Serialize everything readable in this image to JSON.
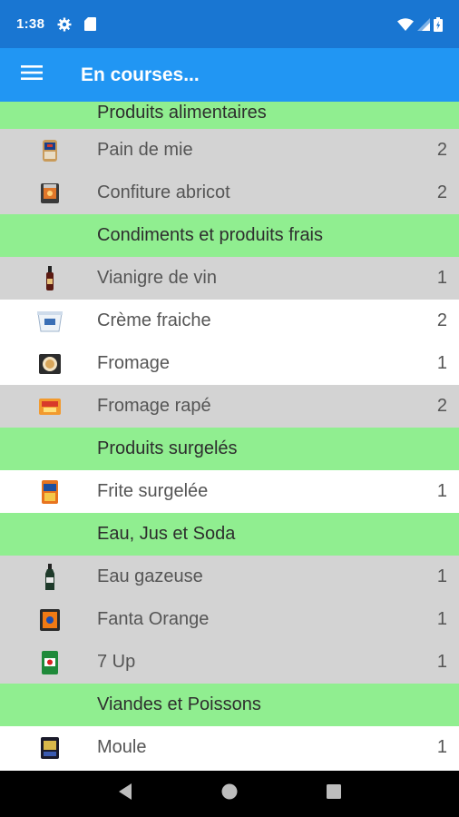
{
  "status_bar": {
    "time": "1:38",
    "icons": [
      "gear-icon",
      "sd-card-icon",
      "wifi-icon",
      "signal-icon",
      "battery-icon"
    ]
  },
  "app_bar": {
    "title": "En courses...",
    "menu_icon": "hamburger-menu-icon",
    "color": "#2196f3"
  },
  "sections": [
    {
      "title": "Produits alimentaires",
      "items": [
        {
          "name": "Pain de mie",
          "qty": "2",
          "row": "gray"
        },
        {
          "name": "Confiture abricot",
          "qty": "2",
          "row": "gray"
        }
      ]
    },
    {
      "title": "Condiments et produits frais",
      "items": [
        {
          "name": "Vianigre de vin",
          "qty": "1",
          "row": "gray"
        },
        {
          "name": "Crème fraiche",
          "qty": "2",
          "row": "white"
        },
        {
          "name": "Fromage",
          "qty": "1",
          "row": "white"
        },
        {
          "name": "Fromage rapé",
          "qty": "2",
          "row": "gray"
        }
      ]
    },
    {
      "title": "Produits surgelés",
      "items": [
        {
          "name": "Frite surgelée",
          "qty": "1",
          "row": "white"
        }
      ]
    },
    {
      "title": "Eau, Jus et Soda",
      "items": [
        {
          "name": "Eau gazeuse",
          "qty": "1",
          "row": "gray"
        },
        {
          "name": "Fanta Orange",
          "qty": "1",
          "row": "gray"
        },
        {
          "name": "7 Up",
          "qty": "1",
          "row": "gray"
        }
      ]
    },
    {
      "title": "Viandes et Poissons",
      "items": [
        {
          "name": "Moule",
          "qty": "1",
          "row": "white"
        }
      ]
    }
  ],
  "nav_bar": {
    "icons": [
      "back-icon",
      "home-icon",
      "recents-icon"
    ]
  },
  "colors": {
    "status_bar": "#1976d2",
    "app_bar": "#2196f3",
    "section_header": "#90ee90",
    "row_gray": "#d3d3d3",
    "row_white": "#ffffff"
  }
}
